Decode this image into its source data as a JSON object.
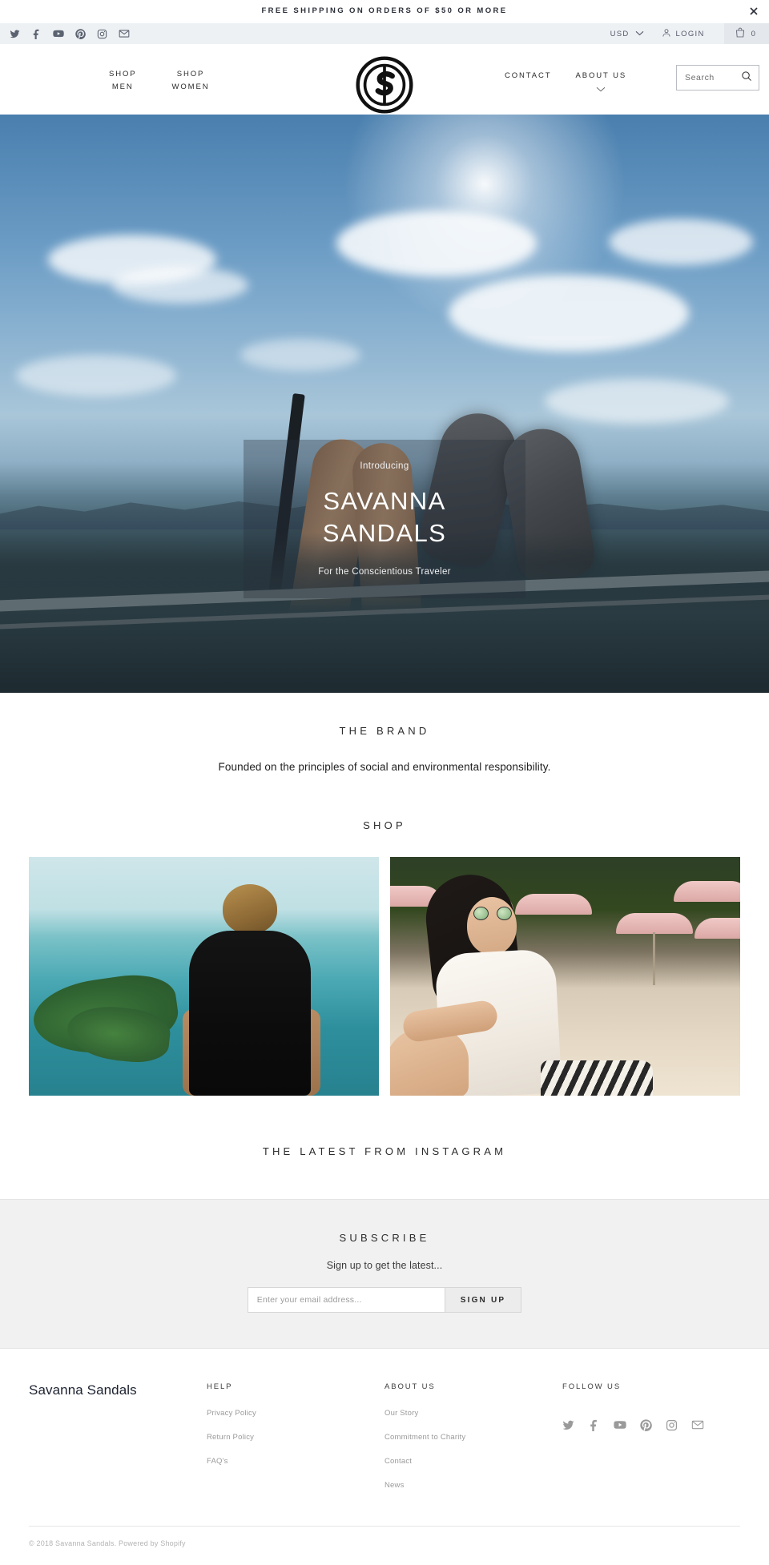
{
  "announcement": {
    "text": "FREE SHIPPING ON ORDERS OF $50 OR MORE",
    "close_icon": "close-icon"
  },
  "utility_bar": {
    "social": [
      {
        "name": "twitter-icon",
        "label": "Twitter"
      },
      {
        "name": "facebook-icon",
        "label": "Facebook"
      },
      {
        "name": "youtube-icon",
        "label": "YouTube"
      },
      {
        "name": "pinterest-icon",
        "label": "Pinterest"
      },
      {
        "name": "instagram-icon",
        "label": "Instagram"
      },
      {
        "name": "email-icon",
        "label": "Email"
      }
    ],
    "currency": "USD",
    "currency_caret": "chevron-down-icon",
    "login_label": "LOGIN",
    "login_icon": "user-icon",
    "cart_icon": "shopping-bag-icon",
    "cart_count": "0"
  },
  "header": {
    "nav_left": [
      {
        "line1": "SHOP",
        "line2": "MEN"
      },
      {
        "line1": "SHOP",
        "line2": "WOMEN"
      }
    ],
    "nav_right": [
      {
        "label": "CONTACT",
        "caret": false
      },
      {
        "label": "ABOUT US",
        "caret": true
      }
    ],
    "logo_alt": "Savanna Sandals logo",
    "search": {
      "placeholder": "Search",
      "value": "",
      "icon": "search-icon"
    }
  },
  "hero": {
    "pretitle": "Introducing",
    "title_line1": "SAVANNA",
    "title_line2": "SANDALS",
    "subtitle": "For the Conscientious Traveler"
  },
  "brand_section": {
    "title": "THE BRAND",
    "subtitle": "Founded on the principles of social and environmental responsibility."
  },
  "shop_section": {
    "title": "SHOP",
    "cards": [
      {
        "name": "shop-men-card",
        "alt": "Man in black shirt overlooking a lake"
      },
      {
        "name": "shop-women-card",
        "alt": "Woman in white dress at the beach"
      }
    ]
  },
  "instagram_section": {
    "title": "THE LATEST FROM INSTAGRAM"
  },
  "newsletter": {
    "title": "SUBSCRIBE",
    "subtitle": "Sign up to get the latest...",
    "input_placeholder": "Enter your email address...",
    "input_value": "",
    "button_label": "SIGN UP"
  },
  "footer": {
    "brand_name": "Savanna Sandals",
    "columns": [
      {
        "heading": "HELP",
        "links": [
          "Privacy Policy",
          "Return Policy",
          "FAQ's"
        ]
      },
      {
        "heading": "ABOUT US",
        "links": [
          "Our Story",
          "Commitment to Charity",
          "Contact",
          "News"
        ]
      }
    ],
    "follow_heading": "FOLLOW US",
    "social": [
      {
        "name": "twitter-icon",
        "label": "Twitter"
      },
      {
        "name": "facebook-icon",
        "label": "Facebook"
      },
      {
        "name": "youtube-icon",
        "label": "YouTube"
      },
      {
        "name": "pinterest-icon",
        "label": "Pinterest"
      },
      {
        "name": "instagram-icon",
        "label": "Instagram"
      },
      {
        "name": "email-icon",
        "label": "Email"
      }
    ],
    "copyright": "© 2018 Savanna Sandals. Powered by Shopify"
  },
  "colors": {
    "utility_bar_bg": "#eef1f4",
    "cart_bg": "#e4e8ec",
    "newsletter_bg": "#f1f1f1",
    "text_dark": "#1d1d1d",
    "text_muted": "#9a9a9a",
    "border": "#e6e6e6"
  }
}
